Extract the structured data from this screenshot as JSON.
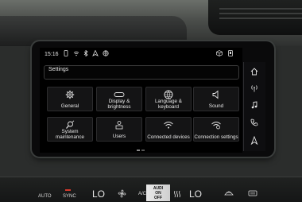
{
  "status": {
    "time": "15:16",
    "icons": [
      "phone-link-icon",
      "wifi-icon",
      "bluetooth-icon",
      "navigation-icon",
      "globe-icon"
    ],
    "right_icons": [
      "cube-icon",
      "mobile-icon"
    ]
  },
  "screen": {
    "title": "Settings",
    "tiles": [
      {
        "label": "General",
        "icon": "gear-icon"
      },
      {
        "label": "Display & brightness",
        "icon": "display-icon"
      },
      {
        "label": "Language & keyboard",
        "icon": "globe-icon"
      },
      {
        "label": "Sound",
        "icon": "speaker-icon"
      },
      {
        "label": "System maintenance",
        "icon": "wrench-icon"
      },
      {
        "label": "Users",
        "icon": "users-icon"
      },
      {
        "label": "Connected devices",
        "icon": "wifi-icon"
      },
      {
        "label": "Connection settings",
        "icon": "connection-settings-icon"
      }
    ]
  },
  "side_nav": [
    "home-icon",
    "antenna-icon",
    "music-icon",
    "phone-icon",
    "nav-arrow-icon"
  ],
  "climate": {
    "auto": "AUTO",
    "sync": "SYNC",
    "left_temp": "LO",
    "ac": "A/C",
    "right_temp": "LO",
    "center_stack": [
      "AUDI",
      "ON",
      "OFF"
    ]
  }
}
